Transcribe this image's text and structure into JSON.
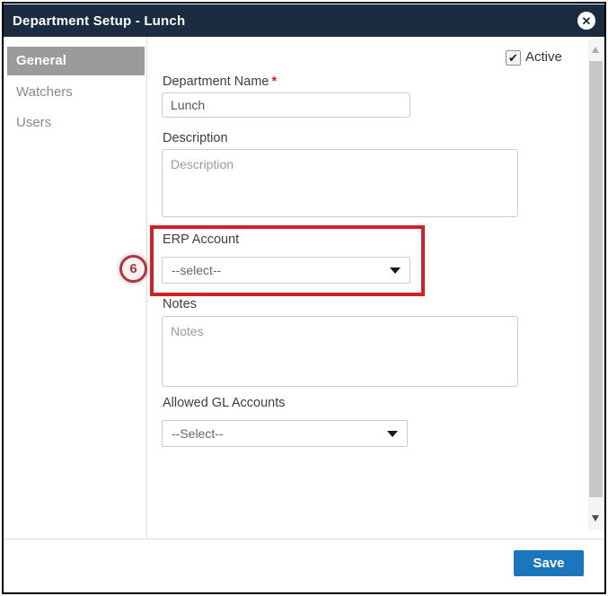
{
  "modal": {
    "title": "Department Setup - Lunch",
    "close_icon": "✕"
  },
  "sidebar": {
    "items": [
      {
        "label": "General",
        "active": true
      },
      {
        "label": "Watchers",
        "active": false
      },
      {
        "label": "Users",
        "active": false
      }
    ]
  },
  "form": {
    "active_checkbox": {
      "label": "Active",
      "checked": true,
      "checkmark": "✔"
    },
    "department_name": {
      "label": "Department Name",
      "required_marker": "*",
      "value": "Lunch"
    },
    "description": {
      "label": "Description",
      "placeholder": "Description",
      "value": ""
    },
    "erp_account": {
      "label": "ERP Account",
      "selected": "--select--"
    },
    "notes": {
      "label": "Notes",
      "placeholder": "Notes",
      "value": ""
    },
    "allowed_gl_accounts": {
      "label": "Allowed GL Accounts",
      "selected": "--Select--"
    }
  },
  "annotation": {
    "step_number": "6"
  },
  "footer": {
    "save_label": "Save"
  },
  "colors": {
    "header_bg": "#1b2c41",
    "active_tab_bg": "#9b9b9b",
    "save_button_bg": "#1b76bd",
    "annotation_rect_red": "#cf2127",
    "annotation_circle_red": "#a63a40",
    "required_asterisk": "#e02020"
  }
}
